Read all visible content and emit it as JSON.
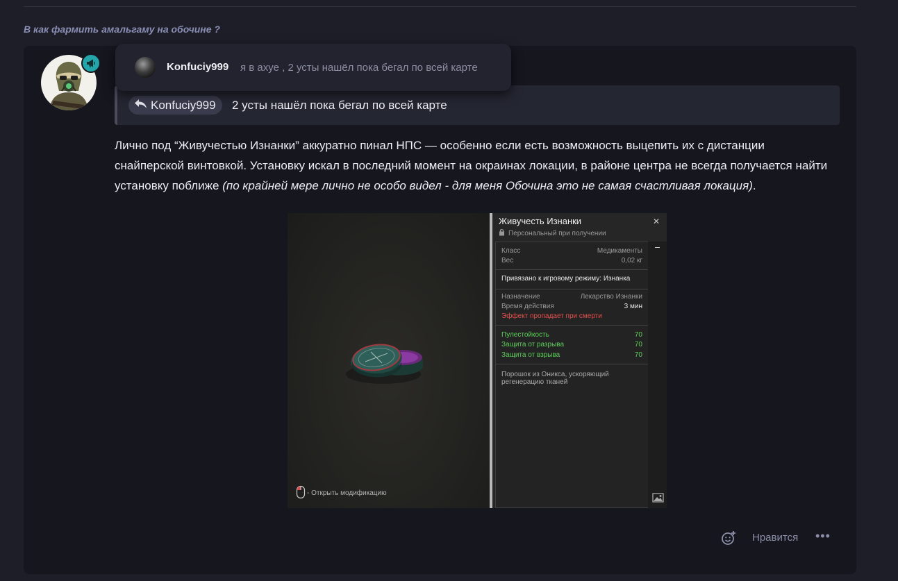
{
  "thread": {
    "title": "В как фармить амальгаму на обочине ?"
  },
  "tooltip": {
    "username": "Konfuciy999",
    "text": "я в ахуе , 2 усты нашёл пока бегал по всей карте"
  },
  "quote": {
    "username": "Konfuciy999",
    "text": "2 усты нашёл пока бегал по всей карте"
  },
  "post": {
    "text_main": "Лично под “Живучестью Изнанки” аккуратно пинал НПС — особенно если есть возможность выцепить их с дистанции снайперской винтовкой. Установку искал в последний момент на окраинах локации, в районе центра не всегда получается найти установку поближе ",
    "text_italic": "(по крайней мере лично не особо видел - для меня Обочина это не самая счастливая локация)",
    "text_end": "."
  },
  "game": {
    "hint": "- Открыть модификацию",
    "item_title": "Живучесть Изнанки",
    "item_subtitle": "Персональный при получении",
    "class_label": "Класс",
    "class_value": "Медикаменты",
    "weight_label": "Вес",
    "weight_value": "0,02 кг",
    "bound_text": "Привязано к игровому режиму: Изнанка",
    "purpose_label": "Назначение",
    "purpose_value": "Лекарство Изнанки",
    "duration_label": "Время действия",
    "duration_value": "3 мин",
    "death_warning": "Эффект пропадает при смерти",
    "stats": [
      {
        "label": "Пулестойкость",
        "value": "70"
      },
      {
        "label": "Защита от разрыва",
        "value": "70"
      },
      {
        "label": "Защита от взрыва",
        "value": "70"
      }
    ],
    "description": "Порошок из Оникса, ускоряющий регенерацию тканей",
    "close_glyph": "✕"
  },
  "actions": {
    "like_label": "Нравится",
    "more_glyph": "•••"
  },
  "colors": {
    "background": "#1d1e27",
    "card": "#15161e",
    "accent_badge": "#23a5a9",
    "title": "#8a8eb4"
  }
}
